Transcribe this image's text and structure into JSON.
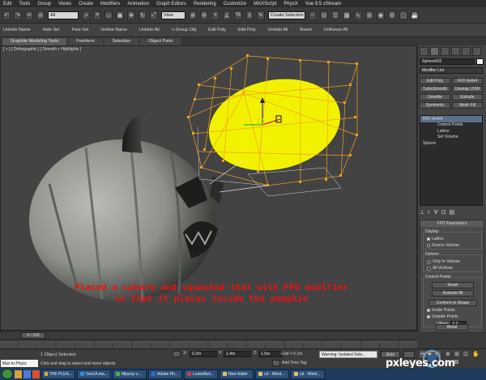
{
  "menu": [
    "Edit",
    "Tools",
    "Group",
    "Views",
    "Create",
    "Modifiers",
    "Animation",
    "Graph Editors",
    "Rendering",
    "Customize",
    "MAXScript",
    "PhysX",
    "Vue 9.5 xStream"
  ],
  "toolbar": {
    "filter_value": "All",
    "refcoord_value": "View",
    "selection_set_value": "Create Selection"
  },
  "ribbon": [
    "Unhide Name",
    "Hide Sel",
    "Free Sel",
    "Unfree Name",
    "Unhide All",
    "Edit Poly",
    "Edit Poly",
    "Unhide All",
    "Reset",
    "Unfreeze All"
  ],
  "ribbon_group": "<-Group Obj",
  "tabs": [
    "Graphite Modeling Tools",
    "Freeform",
    "Selection",
    "Object Paint"
  ],
  "viewport_label": "[ + ] [ Orthographic ] [ Smooth + Highlights ]",
  "annotation": {
    "line1": "Placed a sphere and squashed that with FFD modifier",
    "line2": "so that it places inside the pumpkin"
  },
  "panel": {
    "object_name": "Sphere002",
    "modifier_list": "Modifier List",
    "buttons": [
      [
        "Edit Poly",
        "FFD 4x4x4"
      ],
      [
        "TurboSmooth",
        "Unwrap UVW"
      ],
      [
        "Greeble",
        "Extrude"
      ],
      [
        "Symmetry",
        "Mesh Fill"
      ]
    ],
    "stack": [
      {
        "label": "FFD 4x4x4",
        "selected": true,
        "indent": 0
      },
      {
        "label": "Control Points",
        "selected": false,
        "indent": 1
      },
      {
        "label": "Lattice",
        "selected": false,
        "indent": 1
      },
      {
        "label": "Set Volume",
        "selected": false,
        "indent": 1
      },
      {
        "label": "Sphere",
        "selected": false,
        "indent": 0
      }
    ],
    "rollout_title": "FFD Parameters",
    "display_title": "Display:",
    "display_opts": [
      "Lattice",
      "Source Volume"
    ],
    "deform_title": "Deform:",
    "deform_opts": [
      "Only In Volume",
      "All Vertices"
    ],
    "cp_title": "Control Points:",
    "cp_buttons": [
      "Reset",
      "Animate All"
    ],
    "conform_button": "Conform to Shape",
    "conform_opts": [
      "Inside Points",
      "Outside Points"
    ],
    "offset_label": "Offset:",
    "offset_value": "0.0",
    "about_button": "About"
  },
  "timeline": {
    "frame": "0 / 100"
  },
  "status": {
    "maxscript": "Max to Physc",
    "selected": "1 Object Selected",
    "prompt": "Click and drag to select and move objects",
    "x": "0.2m",
    "y": "1.4m",
    "z": "1.5m",
    "grid": "Grid = 0.1m",
    "add_time_tag": "Add Time Tag",
    "warning": "Warning: Isolated Sele...",
    "auto": "Auto"
  },
  "taskbar": [
    {
      "label": "THE PLEA...",
      "color": "#e8b030"
    },
    {
      "label": "Vue1A.ma...",
      "color": "#3a8ccf"
    },
    {
      "label": "Mipony v...",
      "color": "#4fb04f"
    },
    {
      "label": "Adobe Ph...",
      "color": "#2c6fbf"
    },
    {
      "label": "LooksBuil...",
      "color": "#d04040"
    },
    {
      "label": "New folder",
      "color": "#e8c060"
    },
    {
      "label": "cd - Wind...",
      "color": "#e8c060"
    },
    {
      "label": "cd - Wind...",
      "color": "#e8c060"
    }
  ],
  "watermark": "pxleyes.com",
  "colors": {
    "sphere": "#f2f200",
    "lattice": "#f0a020",
    "annotation": "#e41414",
    "pumpkin": "#9aa094"
  }
}
